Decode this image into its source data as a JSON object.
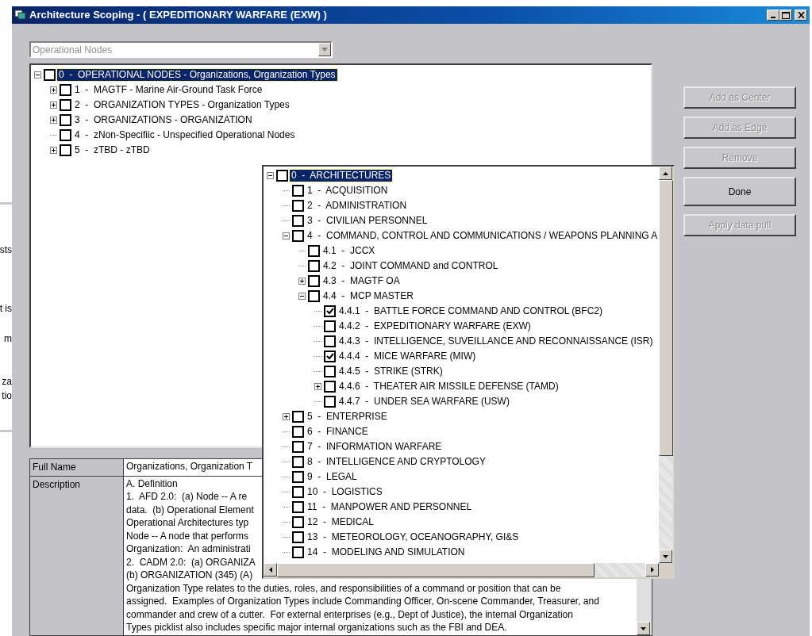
{
  "window": {
    "title": "Architecture Scoping - ( EXPEDITIONARY WARFARE (EXW) )"
  },
  "background_window": {
    "texts": [
      "sts",
      "t is",
      "m",
      "za",
      "tio"
    ]
  },
  "node_type_dropdown": {
    "value": "Operational Nodes",
    "disabled": true
  },
  "operational_tree": [
    {
      "label": "0  -  OPERATIONAL NODES - Organizations, Organization Types",
      "checked": false,
      "selected": true,
      "expanded": true,
      "children": [
        {
          "label": "1  -  MAGTF - Marine Air-Ground Task Force",
          "checked": false,
          "selected": false,
          "expanded": false
        },
        {
          "label": "2  -  ORGANIZATION TYPES - Organization Types",
          "checked": false,
          "selected": false,
          "expanded": false
        },
        {
          "label": "3  -  ORGANIZATIONS - ORGANIZATION",
          "checked": false,
          "selected": false,
          "expanded": false
        },
        {
          "label": "4  -  zNon-Specifiic - Unspecified Operational Nodes",
          "checked": false,
          "selected": false
        },
        {
          "label": "5  -  zTBD - zTBD",
          "checked": false,
          "selected": false,
          "expanded": false
        }
      ]
    }
  ],
  "buttons": [
    {
      "label": "Add as Center",
      "disabled": true
    },
    {
      "label": "Add as Edge",
      "disabled": true
    },
    {
      "label": "Remove",
      "disabled": true
    },
    {
      "label": "Done",
      "disabled": false
    },
    {
      "label": "Apply data pull",
      "disabled": true
    }
  ],
  "architecture_tree": [
    {
      "label": "0  -  ARCHITECTURES",
      "checked": false,
      "selected": true,
      "expanded": true,
      "children": [
        {
          "label": "1  -  ACQUISITION",
          "checked": false,
          "selected": false
        },
        {
          "label": "2  -  ADMINISTRATION",
          "checked": false,
          "selected": false
        },
        {
          "label": "3  -  CIVILIAN PERSONNEL",
          "checked": false,
          "selected": false
        },
        {
          "label": "4  -  COMMAND, CONTROL AND COMMUNICATIONS / WEAPONS PLANNING A",
          "checked": false,
          "selected": false,
          "expanded": true,
          "children": [
            {
              "label": "4.1  -  JCCX",
              "checked": false,
              "selected": false
            },
            {
              "label": "4.2  -  JOINT COMMAND and CONTROL",
              "checked": false,
              "selected": false
            },
            {
              "label": "4.3  -  MAGTF OA",
              "checked": false,
              "selected": false,
              "expanded": false
            },
            {
              "label": "4.4  -  MCP MASTER",
              "checked": false,
              "selected": false,
              "expanded": true,
              "children": [
                {
                  "label": "4.4.1  -  BATTLE FORCE COMMAND AND CONTROL (BFC2)",
                  "checked": true,
                  "selected": false
                },
                {
                  "label": "4.4.2  -  EXPEDITIONARY WARFARE (EXW)",
                  "checked": false,
                  "selected": false
                },
                {
                  "label": "4.4.3  -  INTELLIGENCE, SUVEILLANCE AND RECONNAISSANCE (ISR)",
                  "checked": false,
                  "selected": false
                },
                {
                  "label": "4.4.4  -  MICE WARFARE (MIW)",
                  "checked": true,
                  "selected": false
                },
                {
                  "label": "4.4.5  -  STRIKE (STRK)",
                  "checked": false,
                  "selected": false
                },
                {
                  "label": "4.4.6  -  THEATER AIR MISSILE DEFENSE (TAMD)",
                  "checked": false,
                  "selected": false,
                  "expanded": false
                },
                {
                  "label": "4.4.7  -  UNDER SEA WARFARE (USW)",
                  "checked": false,
                  "selected": false
                }
              ]
            }
          ]
        },
        {
          "label": "5  -  ENTERPRISE",
          "checked": false,
          "selected": false,
          "expanded": false
        },
        {
          "label": "6  -  FINANCE",
          "checked": false,
          "selected": false
        },
        {
          "label": "7  -  INFORMATION WARFARE",
          "checked": false,
          "selected": false
        },
        {
          "label": "8  -  INTELLIGENCE AND CRYPTOLOGY",
          "checked": false,
          "selected": false
        },
        {
          "label": "9  -  LEGAL",
          "checked": false,
          "selected": false
        },
        {
          "label": "10  -  LOGISTICS",
          "checked": false,
          "selected": false
        },
        {
          "label": "11  -  MANPOWER AND PERSONNEL",
          "checked": false,
          "selected": false
        },
        {
          "label": "12  -  MEDICAL",
          "checked": false,
          "selected": false
        },
        {
          "label": "13  -  METEOROLOGY, OCEANOGRAPHY, GI&S",
          "checked": false,
          "selected": false
        },
        {
          "label": "14  -  MODELING AND SIMULATION",
          "checked": false,
          "selected": false
        }
      ]
    }
  ],
  "details": {
    "rows": [
      {
        "label": "Full Name",
        "lines": [
          "Organizations, Organization T"
        ]
      },
      {
        "label": "Description",
        "lines": [
          "A. Definition",
          "1.  AFD 2.0:  (a) Node -- A re",
          "data.  (b) Operational Element",
          "Operational Architectures typ",
          "Node -- A node that performs",
          "Organization:  An administrati",
          "2.  CADM 2.0:  (a) ORGANIZA",
          "(b) ORGANIZATION (345) (A)",
          "Organization Type relates to the duties, roles, and responsibilities of a command or position that can be",
          "assigned.  Examples of Organization Types include Commanding Officer, On-scene Commander, Treasurer, and",
          "commander and crew of a cutter.  For external enterprises (e.g., Dept of Justice), the internal Organization",
          "Types picklist also includes specific major internal organizations such as the FBI and DEA."
        ]
      }
    ]
  }
}
